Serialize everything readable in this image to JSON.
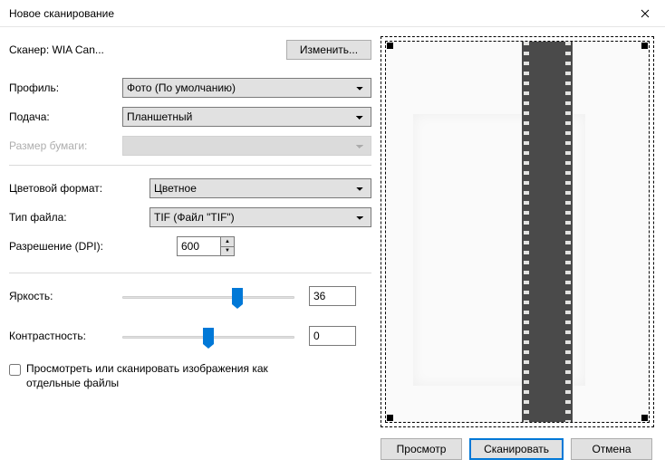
{
  "window": {
    "title": "Новое сканирование"
  },
  "scanner": {
    "label_prefix": "Сканер:",
    "name": "WIA Can...",
    "change_btn": "Изменить..."
  },
  "labels": {
    "profile": "Профиль:",
    "source": "Подача:",
    "paper_size": "Размер бумаги:",
    "color_format": "Цветовой формат:",
    "file_type": "Тип файла:",
    "resolution": "Разрешение (DPI):",
    "brightness": "Яркость:",
    "contrast": "Контрастность:"
  },
  "values": {
    "profile": "Фото (По умолчанию)",
    "source": "Планшетный",
    "paper_size": "",
    "color_format": "Цветное",
    "file_type": "TIF (Файл \"TIF\")",
    "resolution": "600",
    "brightness": "36",
    "contrast": "0"
  },
  "checkbox": {
    "label": "Просмотреть или сканировать изображения как отдельные файлы",
    "checked": false
  },
  "footer": {
    "preview": "Просмотр",
    "scan": "Сканировать",
    "cancel": "Отмена"
  },
  "slider": {
    "brightness_pos_pct": 68,
    "contrast_pos_pct": 50
  }
}
